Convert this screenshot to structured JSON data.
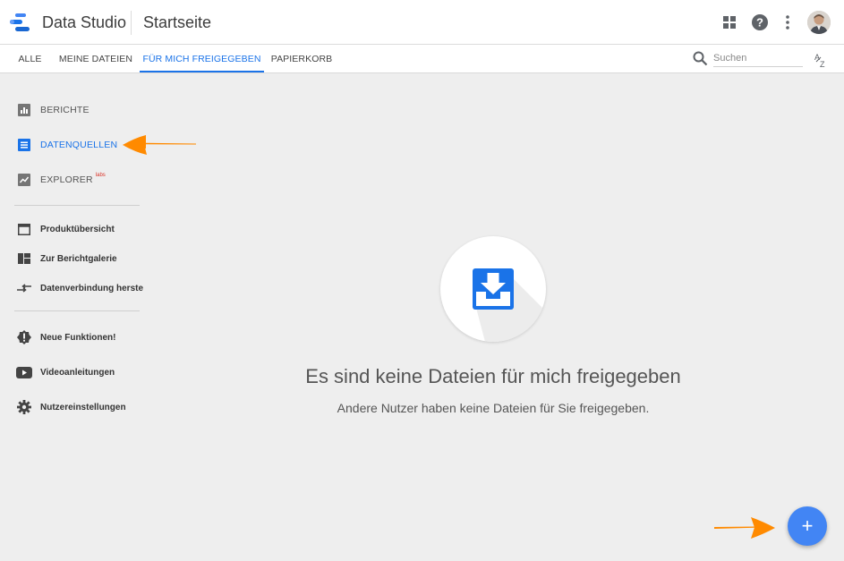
{
  "header": {
    "app_name": "Data Studio",
    "page_title": "Startseite",
    "icons": [
      "apps-grid-icon",
      "help-icon",
      "more-vert-icon"
    ]
  },
  "tabs": [
    {
      "label": "ALLE",
      "active": false
    },
    {
      "label": "MEINE DATEIEN",
      "active": false
    },
    {
      "label": "FÜR MICH FREIGEGEBEN",
      "active": true
    },
    {
      "label": "PAPIERKORB",
      "active": false
    }
  ],
  "search": {
    "placeholder": "Suchen",
    "value": ""
  },
  "sidebar": {
    "primary": [
      {
        "label": "BERICHTE",
        "icon": "bar-chart-icon",
        "active": false
      },
      {
        "label": "DATENQUELLEN",
        "icon": "list-icon",
        "active": true
      },
      {
        "label": "EXPLORER",
        "icon": "explore-chart-icon",
        "active": false,
        "badge": "labs"
      }
    ],
    "secondary": [
      {
        "label": "Produktübersicht",
        "icon": "window-icon"
      },
      {
        "label": "Zur Berichtgalerie",
        "icon": "dashboard-icon"
      },
      {
        "label": "Datenverbindung herste",
        "icon": "connect-arrows-icon"
      }
    ],
    "tertiary": [
      {
        "label": "Neue Funktionen!",
        "icon": "alert-badge-icon"
      },
      {
        "label": "Videoanleitungen",
        "icon": "youtube-icon"
      },
      {
        "label": "Nutzereinstellungen",
        "icon": "gear-icon"
      }
    ]
  },
  "empty_state": {
    "title": "Es sind keine Dateien für mich freigegeben",
    "subtitle": "Andere Nutzer haben keine Dateien für Sie freigegeben.",
    "icon": "inbox-download-icon"
  },
  "fab": {
    "label": "+"
  },
  "colors": {
    "accent": "#1a73e8",
    "fab": "#4285f4",
    "annotation_arrow": "#ff8a00",
    "background": "#eeeeee"
  }
}
